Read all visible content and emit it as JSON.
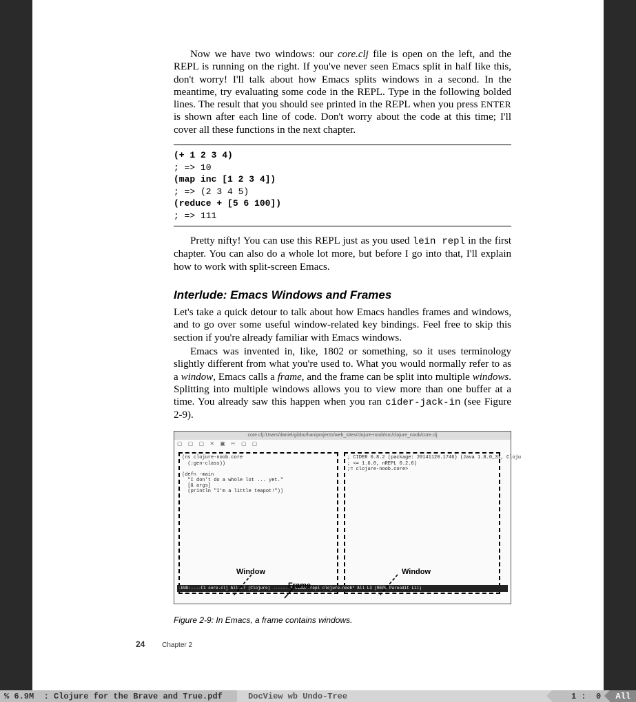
{
  "para1": {
    "lead": "Now we have two windows: our ",
    "file": "core.clj",
    "mid1": " file is open on the left, and the REPL is running on the right. If you've never seen Emacs split in half like this, don't worry! I'll talk about how Emacs splits windows in a second. In the meantime, try evaluating some code in the REPL. Type in the following bolded lines. The result that you should see printed in the REPL when you press ",
    "key": "ENTER",
    "tail": " is shown after each line of code. Don't worry about the code at this time; I'll cover all these functions in the next chapter."
  },
  "code": {
    "l1": "(+ 1 2 3 4)",
    "l2": "; => 10",
    "l3": "(map inc [1 2 3 4])",
    "l4": "; => (2 3 4 5)",
    "l5": "(reduce + [5 6 100])",
    "l6": "; => 111"
  },
  "para2": {
    "lead": "Pretty nifty! You can use this REPL just as you used ",
    "cmd": "lein repl",
    "tail": " in the first chapter. You can also do a whole lot more, but before I go into that, I'll explain how to work with split-screen Emacs."
  },
  "heading": "Interlude: Emacs Windows and Frames",
  "para3": "Let's take a quick detour to talk about how Emacs handles frames and windows, and to go over some useful window-related key bindings. Feel free to skip this section if you're already familiar with Emacs windows.",
  "para4": {
    "a": "Emacs was invented in, like, 1802 or something, so it uses terminology slightly different from what you're used to. What you would normally refer to as a ",
    "w1": "window",
    "b": ", Emacs calls a ",
    "w2": "frame",
    "c": ", and the frame can be split into multiple ",
    "w3": "windows",
    "d": ". Splitting into multiple windows allows you to view more than one buffer at a time. You already saw this happen when you ran ",
    "cmd": "cider-jack-in",
    "e": " (see Figure 2-9)."
  },
  "figure": {
    "title": "core.clj:/Users/daniel/gibbo/han/projects/web_sites/clojure-noob/src/clojure_noob/core.clj",
    "left_code": "(ns clojure-noob.core\n  (:gen-class))\n\n(defn -main\n  \"I don't do a whole lot ... yet.\"\n  [& args]\n  (println \"I'm a little teapot!\"))",
    "right_code": "; CIDER 0.8.2 (package: 20141120.1746) (Java 1.8.0_31, Cloju\n; <= 1.6.0, nREPL 0.2.6)\n;= clojure-noob.core> ",
    "bar": "-UUU:----F1  core.clj     All L7  (Clojure) ------  * cider-repl clojure-noob*   All L3   (REPL Pareodit Lil)",
    "label_window": "Window",
    "label_frame": "Frame",
    "caption": "Figure 2-9: In Emacs, a frame contains windows."
  },
  "footer": {
    "page": "24",
    "chapter": "Chapter 2"
  },
  "modeline": {
    "left": "% 6.9M  : Clojure for the Brave and True.pdf ",
    "mode": "DocView wb Undo-Tree ",
    "pos": "  1 :  0 ",
    "all": "All"
  }
}
